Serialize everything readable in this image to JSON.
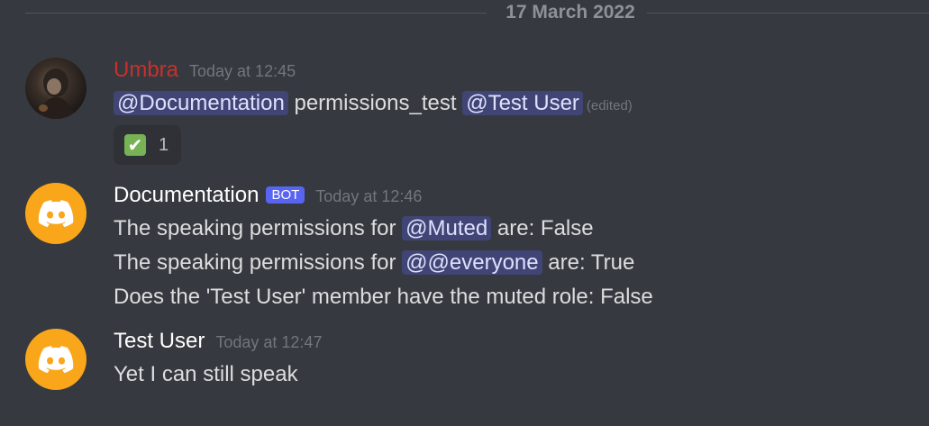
{
  "divider": {
    "date": "17 March 2022"
  },
  "messages": [
    {
      "username": "Umbra",
      "timestamp": "Today at 12:45",
      "line": {
        "mention1": "@Documentation",
        "text": " permissions_test ",
        "mention2": "@Test User",
        "edited": "(edited)"
      },
      "reaction": {
        "emoji": "✔",
        "count": "1"
      }
    },
    {
      "username": "Documentation",
      "bot_tag": "BOT",
      "timestamp": "Today at 12:46",
      "lines": [
        {
          "before": "The speaking permissions for ",
          "mention": "@Muted",
          "after": " are: False"
        },
        {
          "before": "The speaking permissions for ",
          "mention": "@@everyone",
          "after": " are: True"
        },
        {
          "text": "Does the 'Test User' member have the muted role: False"
        }
      ]
    },
    {
      "username": "Test User",
      "timestamp": "Today at 12:47",
      "text": "Yet I can still speak"
    }
  ],
  "colors": {
    "accent": "#5865f2",
    "avatar_bg": "#faa61a",
    "umbra_name": "#c9302c"
  }
}
